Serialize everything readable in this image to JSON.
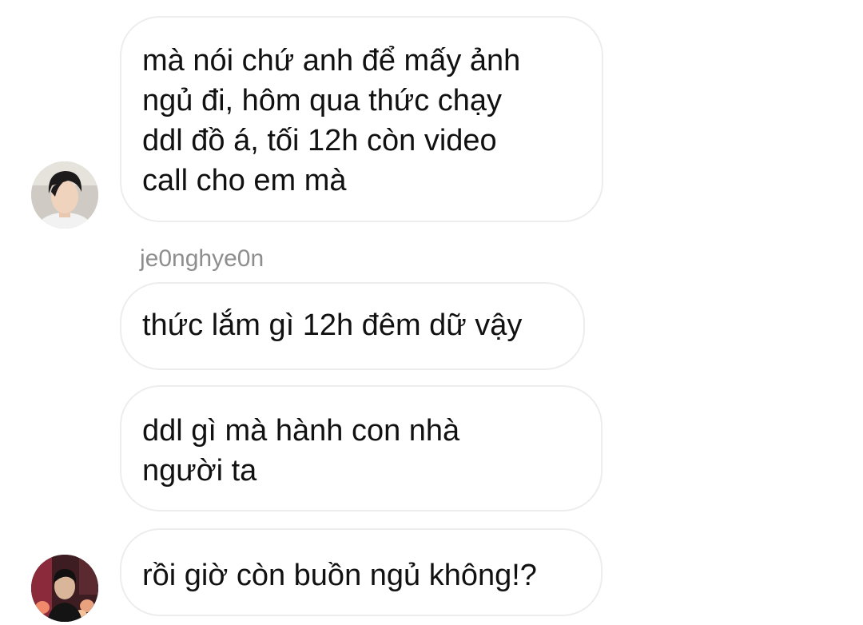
{
  "messages": [
    {
      "lines": [
        "mà nói chứ anh để mấy ảnh",
        "ngủ đi, hôm qua thức chạy",
        "ddl đồ á, tối 12h còn video",
        "call cho em mà"
      ]
    },
    {
      "sender": "je0nghye0n",
      "lines": [
        "thức lắm gì 12h đêm dữ vậy"
      ]
    },
    {
      "lines": [
        "ddl gì mà hành con nhà",
        "người ta"
      ]
    },
    {
      "lines": [
        "rồi giờ còn buồn ngủ không!?"
      ]
    }
  ]
}
